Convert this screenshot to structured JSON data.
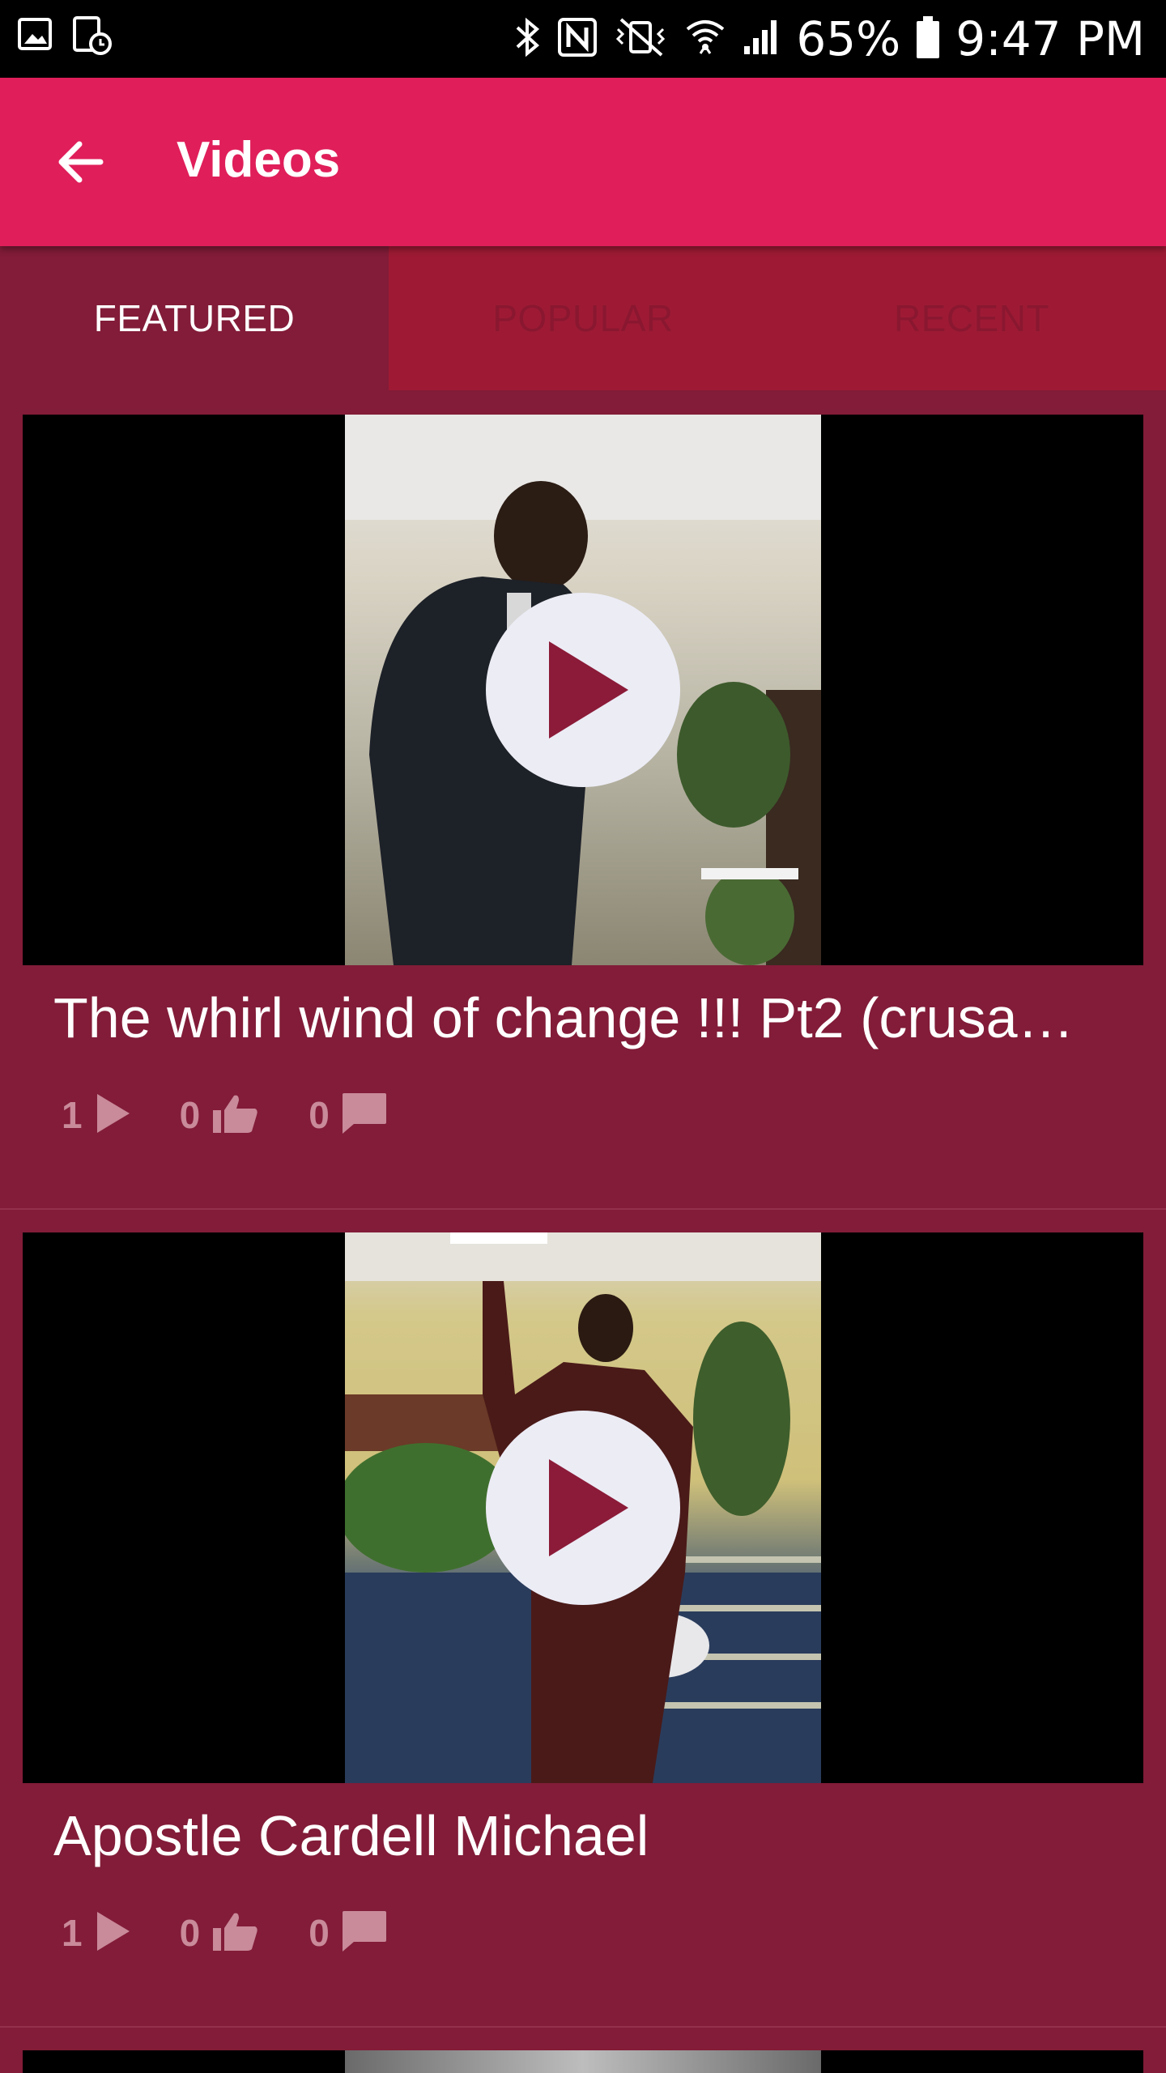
{
  "status_bar": {
    "battery": "65%",
    "time": "9:47 PM"
  },
  "app_bar": {
    "title": "Videos"
  },
  "tabs": [
    {
      "label": "FEATURED",
      "active": true
    },
    {
      "label": "POPULAR",
      "active": false
    },
    {
      "label": "RECENT",
      "active": false
    }
  ],
  "videos": [
    {
      "title": "The whirl wind of change !!! Pt2 (crusa…",
      "views": "1",
      "likes": "0",
      "comments": "0"
    },
    {
      "title": "Apostle Cardell Michael",
      "views": "1",
      "likes": "0",
      "comments": "0"
    }
  ],
  "colors": {
    "app_bar": "#e01e5a",
    "background": "#821c38",
    "inactive_tab": "#9e1a34",
    "play_button": "#ececf5",
    "play_triangle": "#8b1b38"
  },
  "icons": [
    "image-icon",
    "tablet-clock-icon",
    "bluetooth-icon",
    "nfc-icon",
    "mute-vibrate-icon",
    "wifi-icon",
    "signal-icon",
    "battery-icon",
    "back-arrow-icon",
    "play-icon",
    "views-play-icon",
    "thumbs-up-icon",
    "comment-icon"
  ]
}
